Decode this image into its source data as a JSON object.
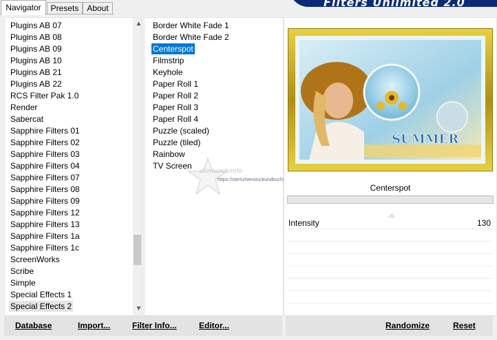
{
  "app": {
    "title": "Filters Unlimited 2.0",
    "accent_color": "#0078d7"
  },
  "tabs": [
    {
      "label": "Navigator",
      "active": true
    },
    {
      "label": "Presets",
      "active": false
    },
    {
      "label": "About",
      "active": false
    }
  ],
  "categories": {
    "items": [
      "Plugins AB 07",
      "Plugins AB 08",
      "Plugins AB 09",
      "Plugins AB 10",
      "Plugins AB 21",
      "Plugins AB 22",
      "RCS Filter Pak 1.0",
      "Render",
      "Sabercat",
      "Sapphire Filters 01",
      "Sapphire Filters 02",
      "Sapphire Filters 03",
      "Sapphire Filters 04",
      "Sapphire Filters 07",
      "Sapphire Filters 08",
      "Sapphire Filters 09",
      "Sapphire Filters 12",
      "Sapphire Filters 13",
      "Sapphire Filters 1a",
      "Sapphire Filters 1c",
      "ScreenWorks",
      "Scribe",
      "Simple",
      "Special Effects 1",
      "Special Effects 2"
    ],
    "selected": "Special Effects 2"
  },
  "filters": {
    "items": [
      "Border White Fade 1",
      "Border White Fade 2",
      "Centerspot",
      "Filmstrip",
      "Keyhole",
      "Paper Roll 1",
      "Paper Roll 2",
      "Paper Roll 3",
      "Paper Roll 4",
      "Puzzle (scaled)",
      "Puzzle (tiled)",
      "Rainbow",
      "TV Screen"
    ],
    "selected": "Centerspot"
  },
  "preview": {
    "text": "SUMMER"
  },
  "watermark": {
    "name": "atomandonde",
    "url": "https://sternchenstuckundbuchstaben.de/"
  },
  "current_filter": "Centerspot",
  "parameters": [
    {
      "label": "Intensity",
      "value": "130"
    }
  ],
  "buttons": {
    "database": "Database",
    "import": "Import...",
    "filter_info": "Filter Info...",
    "editor": "Editor...",
    "randomize": "Randomize",
    "reset": "Reset"
  }
}
